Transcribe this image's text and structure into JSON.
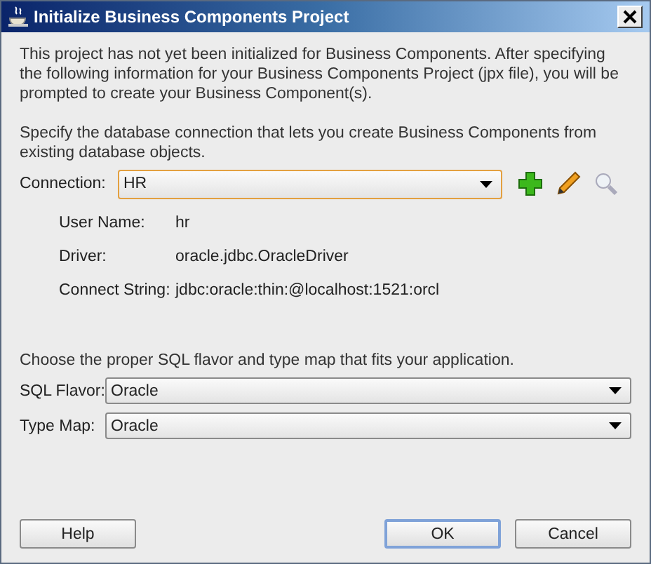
{
  "window": {
    "title": "Initialize Business Components Project"
  },
  "intro": "This project has not yet been initialized for Business Components.  After specifying the following information for your Business Components Project (jpx file), you will be prompted to create your Business Component(s).",
  "connection_hint": "Specify the database connection that lets you create Business Components from existing database objects.",
  "connection": {
    "label": "Connection:",
    "value": "HR"
  },
  "details": [
    {
      "label": "User Name:",
      "value": "hr"
    },
    {
      "label": "Driver:",
      "value": "oracle.jdbc.OracleDriver"
    },
    {
      "label": "Connect String:",
      "value": "jdbc:oracle:thin:@localhost:1521:orcl"
    }
  ],
  "sql_hint": "Choose the proper SQL flavor and type map that fits your application.",
  "selects": [
    {
      "label": "SQL Flavor:",
      "value": "Oracle"
    },
    {
      "label": "Type Map:",
      "value": "Oracle"
    }
  ],
  "buttons": [
    {
      "label": "Help",
      "default": false
    },
    {
      "label": "OK",
      "default": true
    },
    {
      "label": "Cancel",
      "default": false
    }
  ]
}
